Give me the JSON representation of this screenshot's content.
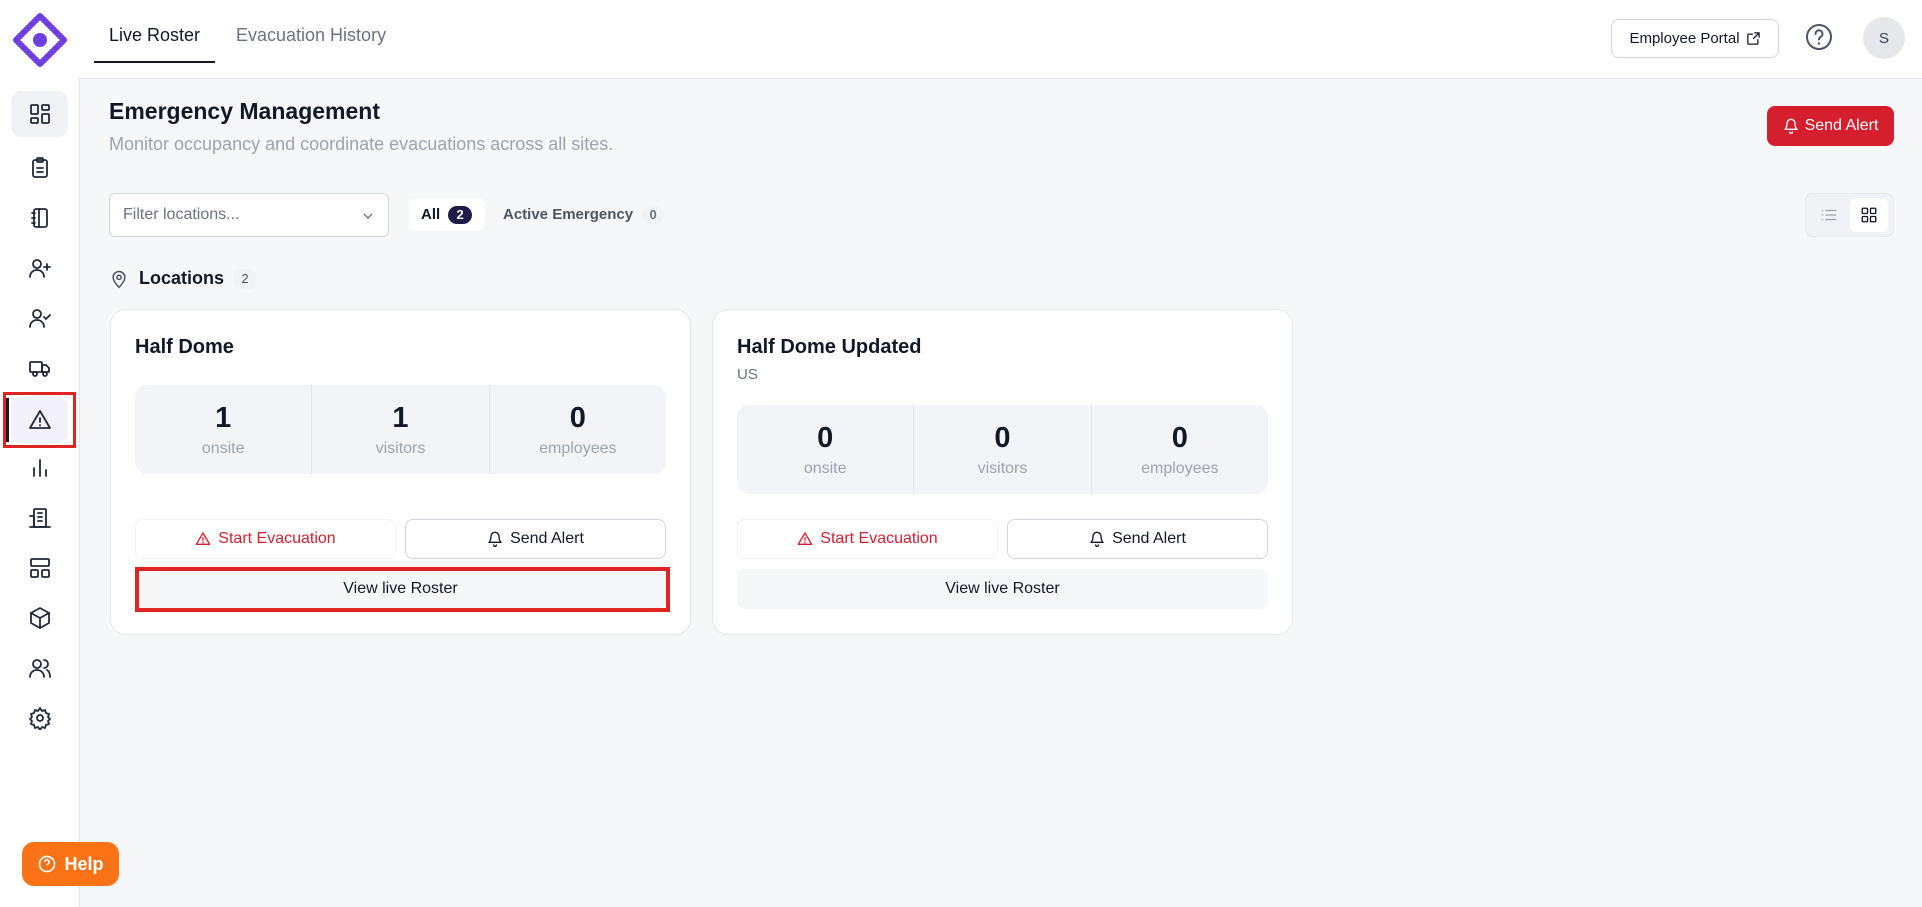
{
  "header": {
    "tabs": [
      {
        "label": "Live Roster",
        "active": true
      },
      {
        "label": "Evacuation History",
        "active": false
      }
    ],
    "portal_label": "Employee Portal",
    "avatar_initial": "S"
  },
  "page": {
    "title": "Emergency Management",
    "subtitle": "Monitor occupancy and coordinate evacuations across all sites.",
    "send_alert_label": "Send Alert"
  },
  "filters": {
    "search_placeholder": "Filter locations...",
    "all_label": "All",
    "all_count": "2",
    "emergency_label": "Active Emergency",
    "emergency_count": "0"
  },
  "locations": {
    "label": "Locations",
    "count": "2",
    "cards": [
      {
        "name": "Half Dome",
        "subtitle": "",
        "stats": [
          {
            "value": "1",
            "label": "onsite"
          },
          {
            "value": "1",
            "label": "visitors"
          },
          {
            "value": "0",
            "label": "employees"
          }
        ],
        "evac_label": "Start Evacuation",
        "alert_label": "Send Alert",
        "roster_label": "View live Roster"
      },
      {
        "name": "Half Dome Updated",
        "subtitle": "US",
        "stats": [
          {
            "value": "0",
            "label": "onsite"
          },
          {
            "value": "0",
            "label": "visitors"
          },
          {
            "value": "0",
            "label": "employees"
          }
        ],
        "evac_label": "Start Evacuation",
        "alert_label": "Send Alert",
        "roster_label": "View live Roster"
      }
    ]
  },
  "help": {
    "label": "Help"
  },
  "sidebar": {
    "items": [
      {
        "icon": "dashboard-icon"
      },
      {
        "icon": "clipboard-icon"
      },
      {
        "icon": "notebook-icon"
      },
      {
        "icon": "user-plus-icon"
      },
      {
        "icon": "user-check-icon"
      },
      {
        "icon": "truck-icon"
      },
      {
        "icon": "alert-triangle-icon",
        "active": true
      },
      {
        "icon": "bar-chart-icon"
      },
      {
        "icon": "building-icon"
      },
      {
        "icon": "layout-icon"
      },
      {
        "icon": "box-icon"
      },
      {
        "icon": "users-icon"
      },
      {
        "icon": "settings-icon"
      }
    ]
  },
  "colors": {
    "brand": "#6d3fe0",
    "alert": "#d51f2f",
    "help": "#f97316",
    "highlight": "#e02424"
  }
}
